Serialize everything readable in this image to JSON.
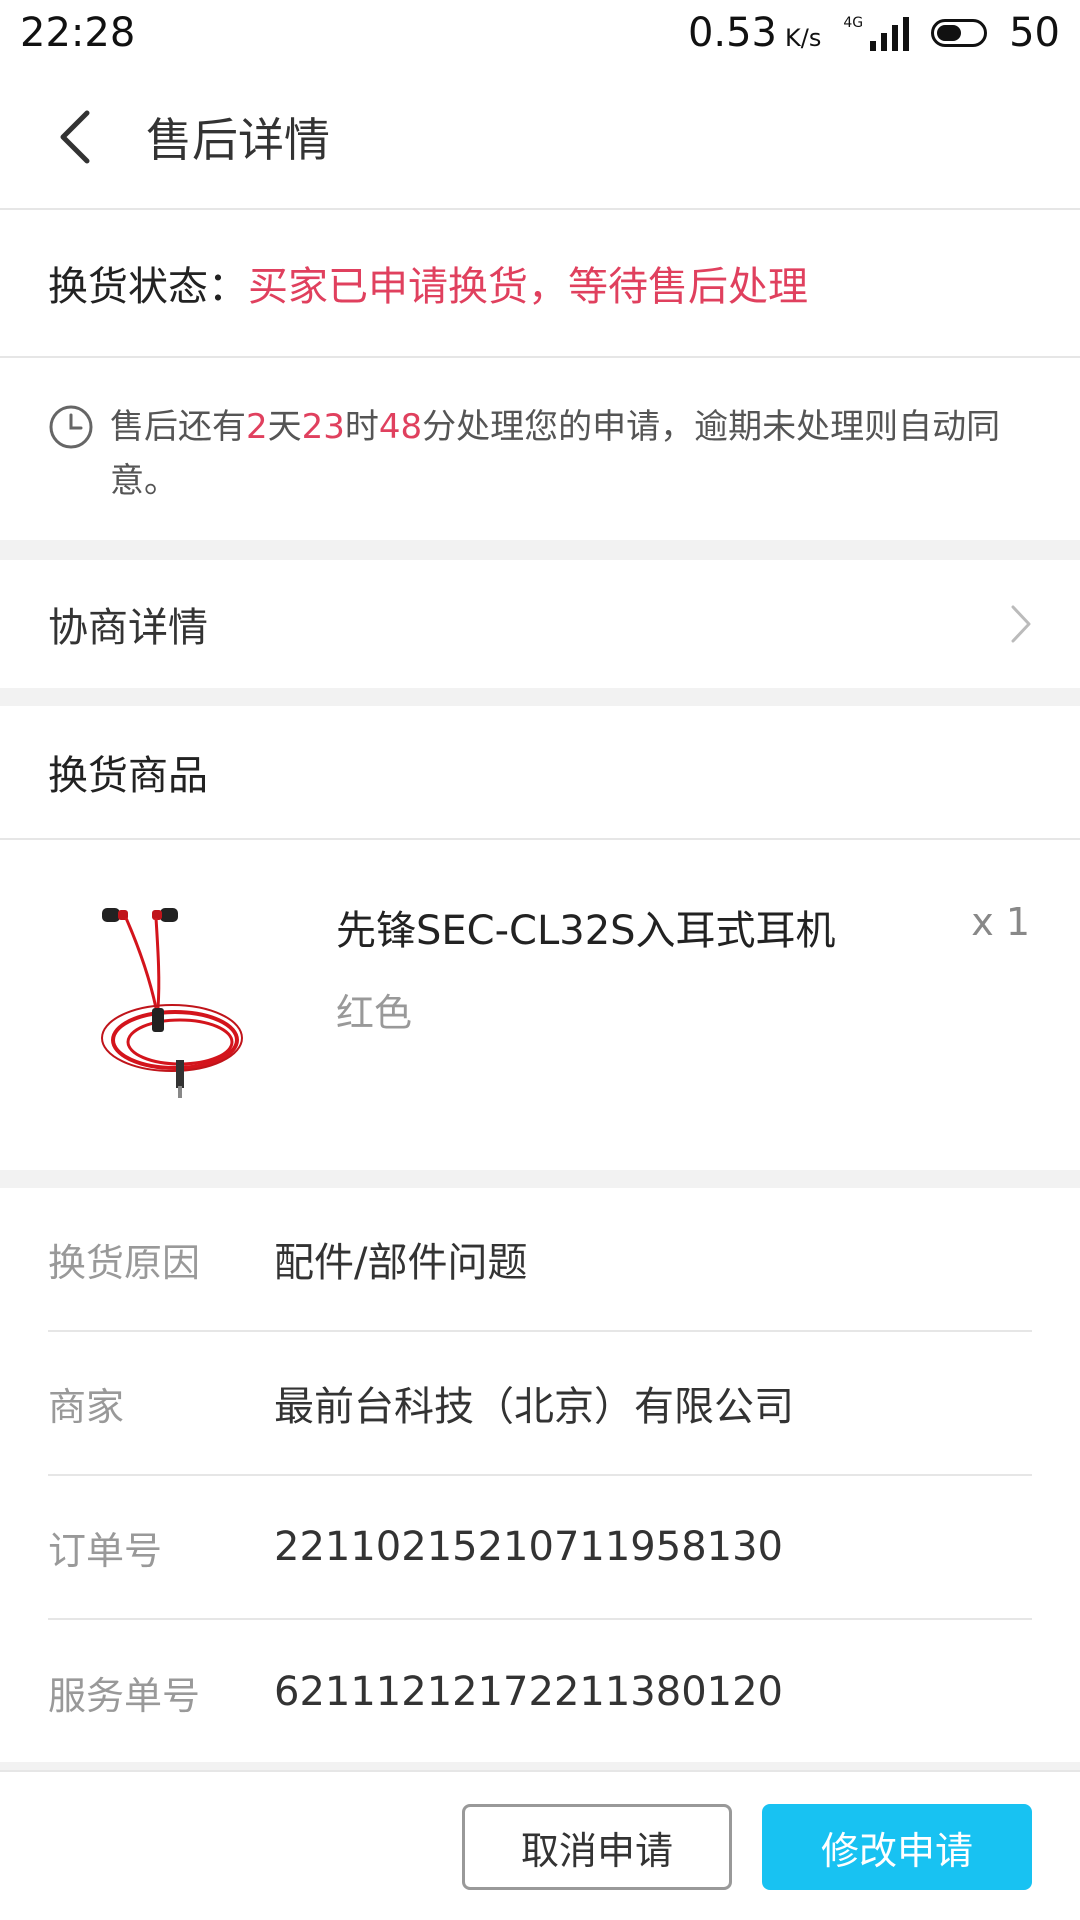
{
  "status_bar": {
    "time": "22:28",
    "net_speed": "0.53",
    "net_unit": "K/s",
    "network_type": "4G",
    "battery": "50"
  },
  "header": {
    "title": "售后详情"
  },
  "status_row": {
    "label": "换货状态：",
    "value": "买家已申请换货，等待售后处理"
  },
  "notice": {
    "p1": "售后还有",
    "days": "2",
    "p2": "天",
    "hours": "23",
    "p3": "时",
    "minutes": "48",
    "p4": "分处理您的申请，逾期未处理则自动同意。"
  },
  "negotiation": {
    "label": "协商详情"
  },
  "goods": {
    "title": "换货商品",
    "name": "先锋SEC-CL32S入耳式耳机",
    "quantity": "x 1",
    "spec": "红色"
  },
  "info": [
    {
      "key": "换货原因",
      "value": "配件/部件问题"
    },
    {
      "key": "商家",
      "value": "最前台科技（北京）有限公司"
    },
    {
      "key": "订单号",
      "value": "2211021521071195813​0"
    },
    {
      "key": "服务单号",
      "value": "621112121722113801​20"
    }
  ],
  "buttons": {
    "cancel": "取消申请",
    "modify": "修改申请"
  },
  "colors": {
    "accent_red": "#e0405e",
    "primary_blue": "#18c2f2"
  }
}
